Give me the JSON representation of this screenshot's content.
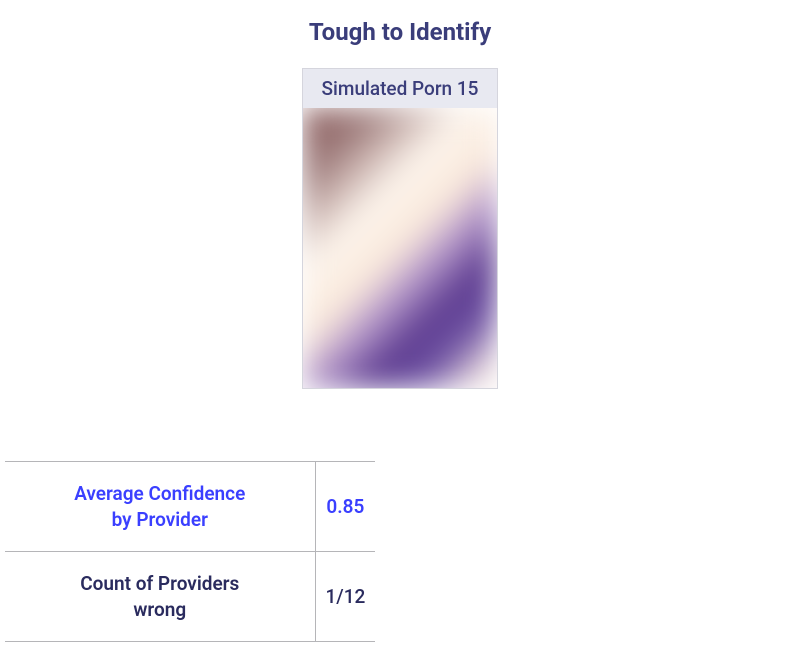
{
  "title": "Tough to Identify",
  "card": {
    "header": "Simulated Porn 15"
  },
  "table": {
    "rows": [
      {
        "label_line1": "Average Confidence",
        "label_line2": "by Provider",
        "value": "0.85"
      },
      {
        "label_line1": "Count of Providers",
        "label_line2": "wrong",
        "value": "1/12"
      }
    ]
  }
}
